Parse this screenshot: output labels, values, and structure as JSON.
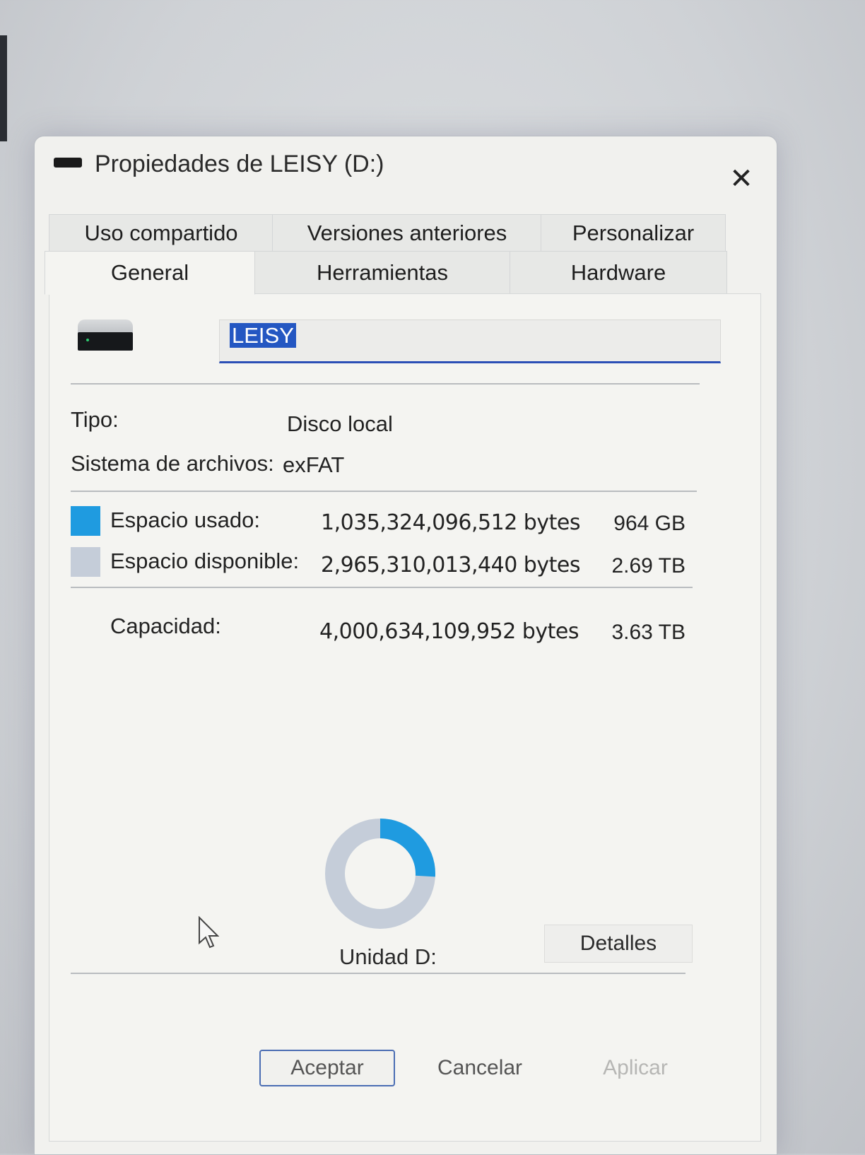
{
  "window": {
    "title": "Propiedades de LEISY (D:)",
    "close": "✕"
  },
  "tabs": {
    "row1": [
      "Uso compartido",
      "Versiones anteriores",
      "Personalizar"
    ],
    "row2": [
      "General",
      "Herramientas",
      "Hardware"
    ],
    "active": "General"
  },
  "general": {
    "drive_name": "LEISY",
    "type_label": "Tipo:",
    "type_value": "Disco local",
    "fs_label": "Sistema de archivos:",
    "fs_value": "exFAT",
    "used": {
      "label": "Espacio usado:",
      "bytes": "1,035,324,096,512 bytes",
      "size": "964 GB",
      "color": "#1f9be0"
    },
    "free": {
      "label": "Espacio disponible:",
      "bytes": "2,965,310,013,440 bytes",
      "size": "2.69 TB",
      "color": "#c5cdd9"
    },
    "capacity": {
      "label": "Capacidad:",
      "bytes": "4,000,634,109,952 bytes",
      "size": "3.63 TB"
    },
    "used_fraction": 0.2588,
    "drive_label": "Unidad D:",
    "details_button": "Detalles"
  },
  "footer": {
    "ok": "Aceptar",
    "cancel": "Cancelar",
    "apply": "Aplicar"
  }
}
